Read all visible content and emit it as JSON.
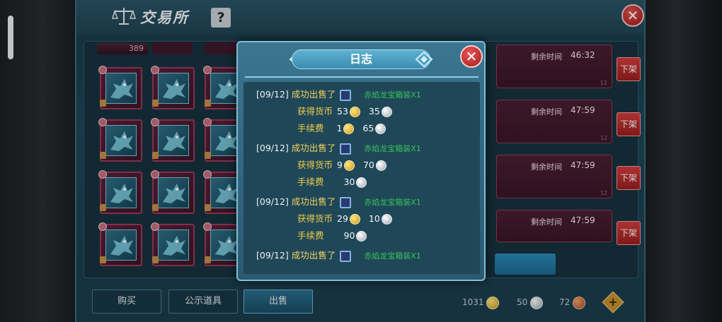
{
  "window": {
    "title": "交易所",
    "help_label": "?",
    "close_label": "✕"
  },
  "inventory": {
    "count": "389"
  },
  "listings": [
    {
      "time_label": "剩余时间",
      "time_value": "46:32",
      "remove_label": "下架",
      "footer": "12"
    },
    {
      "time_label": "剩余时间",
      "time_value": "47:59",
      "remove_label": "下架",
      "footer": "12"
    },
    {
      "time_label": "剩余时间",
      "time_value": "47:59",
      "remove_label": "下架",
      "footer": "12"
    },
    {
      "time_label": "剩余时间",
      "time_value": "47:59",
      "remove_label": "下架",
      "footer": ""
    }
  ],
  "tabs": [
    {
      "label": "购买"
    },
    {
      "label": "公示道具"
    },
    {
      "label": "出售"
    }
  ],
  "currency": {
    "gold": "1031",
    "silver": "50",
    "copper": "72",
    "add_label": "+"
  },
  "log_modal": {
    "title": "日志",
    "close_label": "✕",
    "entries": [
      {
        "date": "[09/12]",
        "action": "成功出售了",
        "item_name": "赤焰龙宝箱装X1",
        "income_label": "获得货币",
        "income_gold": "53",
        "income_silver": "35",
        "fee_label": "手续费",
        "fee_gold": "1",
        "fee_silver": "65"
      },
      {
        "date": "[09/12]",
        "action": "成功出售了",
        "item_name": "赤焰龙宝箱装X1",
        "income_label": "获得货币",
        "income_gold": "9",
        "income_silver": "70",
        "fee_label": "手续费",
        "fee_gold": "",
        "fee_silver": "30"
      },
      {
        "date": "[09/12]",
        "action": "成功出售了",
        "item_name": "赤焰龙宝箱装X1",
        "income_label": "获得货币",
        "income_gold": "29",
        "income_silver": "10",
        "fee_label": "手续费",
        "fee_gold": "",
        "fee_silver": "90"
      },
      {
        "date": "[09/12]",
        "action": "成功出售了",
        "item_name": "赤焰龙宝箱装X1"
      }
    ]
  },
  "colors": {
    "accent_teal": "#3b7590",
    "sell_green": "#39c25a",
    "label_yellow": "#f4d35e",
    "close_red": "#c62828"
  },
  "icons": {
    "title": "scale-icon",
    "items": "dragon-item-icon",
    "gold": "gold-coin-icon",
    "silver": "silver-coin-icon",
    "copper": "copper-coin-icon"
  }
}
